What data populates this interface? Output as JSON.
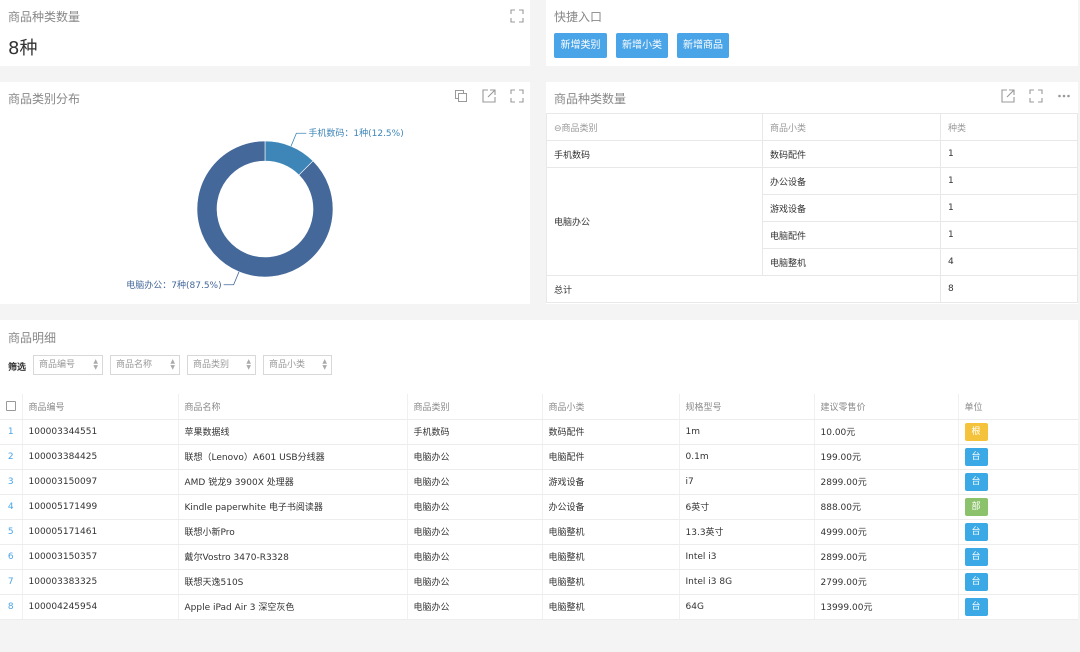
{
  "kpi": {
    "title": "商品种类数量",
    "value": "8种"
  },
  "quick": {
    "title": "快捷入口",
    "buttons": [
      "新增类别",
      "新增小类",
      "新增商品"
    ]
  },
  "pie_panel": {
    "title": "商品类别分布"
  },
  "chart_data": {
    "type": "pie",
    "donut": true,
    "categories": [
      "手机数码",
      "电脑办公"
    ],
    "values": [
      1,
      7
    ],
    "labels": [
      "手机数码：1种(12.5%)",
      "电脑办公：7种(87.5%)"
    ],
    "colors": [
      "#3e86b8",
      "#446899"
    ],
    "title": ""
  },
  "pivot": {
    "title": "商品种类数量",
    "headers": [
      "商品类别",
      "商品小类",
      "种类"
    ],
    "collapse_icon": "⊖",
    "groups": [
      {
        "category": "手机数码",
        "rows": [
          {
            "sub": "数码配件",
            "count": "1"
          }
        ]
      },
      {
        "category": "电脑办公",
        "rows": [
          {
            "sub": "办公设备",
            "count": "1"
          },
          {
            "sub": "游戏设备",
            "count": "1"
          },
          {
            "sub": "电脑配件",
            "count": "1"
          },
          {
            "sub": "电脑整机",
            "count": "4"
          }
        ]
      }
    ],
    "total_label": "总计",
    "total_value": "8"
  },
  "detail": {
    "title": "商品明细",
    "filter_label": "筛选",
    "filters": [
      "商品编号",
      "商品名称",
      "商品类别",
      "商品小类"
    ],
    "columns": [
      "商品编号",
      "商品名称",
      "商品类别",
      "商品小类",
      "规格型号",
      "建议零售价",
      "单位"
    ],
    "rows": [
      {
        "idx": "1",
        "code": "100003344551",
        "name": "苹果数据线",
        "cat": "手机数码",
        "sub": "数码配件",
        "spec": "1m",
        "price": "10.00元",
        "unit": "根",
        "unit_color": "#f5c33b"
      },
      {
        "idx": "2",
        "code": "100003384425",
        "name": "联想（Lenovo）A601 USB分线器",
        "cat": "电脑办公",
        "sub": "电脑配件",
        "spec": "0.1m",
        "price": "199.00元",
        "unit": "台",
        "unit_color": "#3aa9e6"
      },
      {
        "idx": "3",
        "code": "100003150097",
        "name": "AMD 锐龙9 3900X 处理器",
        "cat": "电脑办公",
        "sub": "游戏设备",
        "spec": "i7",
        "price": "2899.00元",
        "unit": "台",
        "unit_color": "#3aa9e6"
      },
      {
        "idx": "4",
        "code": "100005171499",
        "name": "Kindle paperwhite 电子书阅读器",
        "cat": "电脑办公",
        "sub": "办公设备",
        "spec": "6英寸",
        "price": "888.00元",
        "unit": "部",
        "unit_color": "#8cc26b"
      },
      {
        "idx": "5",
        "code": "100005171461",
        "name": "联想小新Pro",
        "cat": "电脑办公",
        "sub": "电脑整机",
        "spec": "13.3英寸",
        "price": "4999.00元",
        "unit": "台",
        "unit_color": "#3aa9e6"
      },
      {
        "idx": "6",
        "code": "100003150357",
        "name": "戴尔Vostro 3470-R3328",
        "cat": "电脑办公",
        "sub": "电脑整机",
        "spec": "Intel i3",
        "price": "2899.00元",
        "unit": "台",
        "unit_color": "#3aa9e6"
      },
      {
        "idx": "7",
        "code": "100003383325",
        "name": "联想天逸510S",
        "cat": "电脑办公",
        "sub": "电脑整机",
        "spec": "Intel i3 8G",
        "price": "2799.00元",
        "unit": "台",
        "unit_color": "#3aa9e6"
      },
      {
        "idx": "8",
        "code": "100004245954",
        "name": "Apple iPad Air 3 深空灰色",
        "cat": "电脑办公",
        "sub": "电脑整机",
        "spec": "64G",
        "price": "13999.00元",
        "unit": "台",
        "unit_color": "#3aa9e6"
      }
    ]
  }
}
